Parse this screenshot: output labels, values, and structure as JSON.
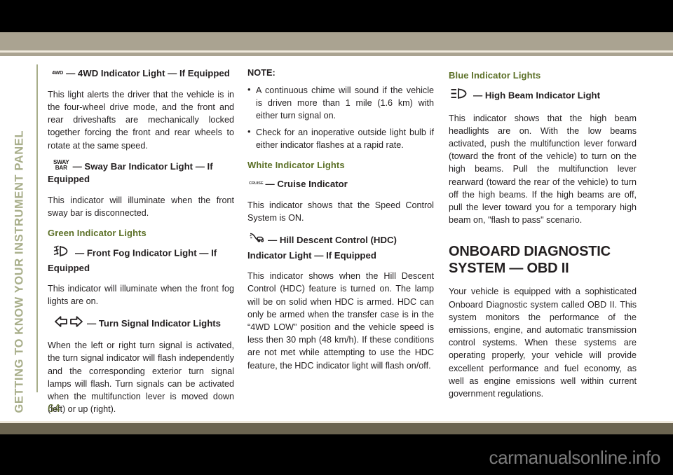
{
  "running_head": "GETTING TO KNOW YOUR INSTRUMENT PANEL",
  "page_number": "64",
  "watermark": "carmanualsonline.info",
  "colors": {
    "band": "#aaa391",
    "band_dark": "#6b6450",
    "heading_green": "#5c7027",
    "sidebar_green": "#a8ae8a",
    "page_number_green": "#5c6a2e",
    "body_text": "#231f20"
  },
  "column1": {
    "item_4wd": {
      "icon_label": "4WD",
      "title": "— 4WD Indicator Light — If Equipped",
      "body": "This light alerts the driver that the vehicle is in the four-wheel drive mode, and the front and rear driveshafts are mechanically locked together forcing the front and rear wheels to rotate at the same speed."
    },
    "item_sway_bar": {
      "icon_label_line1": "SWAY",
      "icon_label_line2": "BAR",
      "title": "— Sway Bar Indicator Light — If Equipped",
      "body": "This indicator will illuminate when the front sway bar is disconnected."
    },
    "green_heading": "Green Indicator Lights",
    "item_front_fog": {
      "title": "— Front Fog Indicator Light — If Equipped",
      "body": "This indicator will illuminate when the front fog lights are on."
    },
    "item_turn_signal": {
      "title": "— Turn Signal Indicator Lights",
      "body": "When the left or right turn signal is activated, the turn signal indicator will flash independently and the corresponding exterior turn signal lamps will flash. Turn signals can be activated when the multifunction lever is moved down (left) or up (right)."
    }
  },
  "column2": {
    "note_label": "NOTE:",
    "note_bullets": [
      "A continuous chime will sound if the vehicle is driven more than 1 mile (1.6 km) with either turn signal on.",
      "Check for an inoperative outside light bulb if either indicator flashes at a rapid rate."
    ],
    "white_heading": "White Indicator Lights",
    "item_cruise": {
      "icon_label": "CRUISE",
      "title": "— Cruise Indicator",
      "body": "This indicator shows that the Speed Control System is ON."
    },
    "item_hdc": {
      "title": "— Hill Descent Control (HDC) Indicator Light — If Equipped",
      "body": "This indicator shows when the Hill Descent Control (HDC) feature is turned on. The lamp will be on solid when HDC is armed. HDC can only be armed when the transfer case is in the “4WD LOW” position and the vehicle speed is less then 30 mph (48 km/h). If these conditions are not met while attempting to use the HDC feature, the HDC indicator light will flash on/off."
    }
  },
  "column3": {
    "blue_heading": "Blue Indicator Lights",
    "item_high_beam": {
      "title": "— High Beam Indicator Light",
      "body": "This indicator shows that the high beam headlights are on. With the low beams activated, push the multifunction lever forward (toward the front of the vehicle) to turn on the high beams. Pull the multifunction lever rearward (toward the rear of the vehicle) to turn off the high beams. If the high beams are off, pull the lever toward you for a temporary high beam on, \"flash to pass\" scenario."
    },
    "obd_heading_line1": "ONBOARD DIAGNOSTIC",
    "obd_heading_line2": "SYSTEM — OBD II",
    "obd_body": "Your vehicle is equipped with a sophisticated Onboard Diagnostic system called OBD II. This system monitors the performance of the emissions, engine, and automatic transmission control systems. When these systems are operating properly, your vehicle will provide excellent performance and fuel economy, as well as engine emissions well within current government regulations."
  }
}
